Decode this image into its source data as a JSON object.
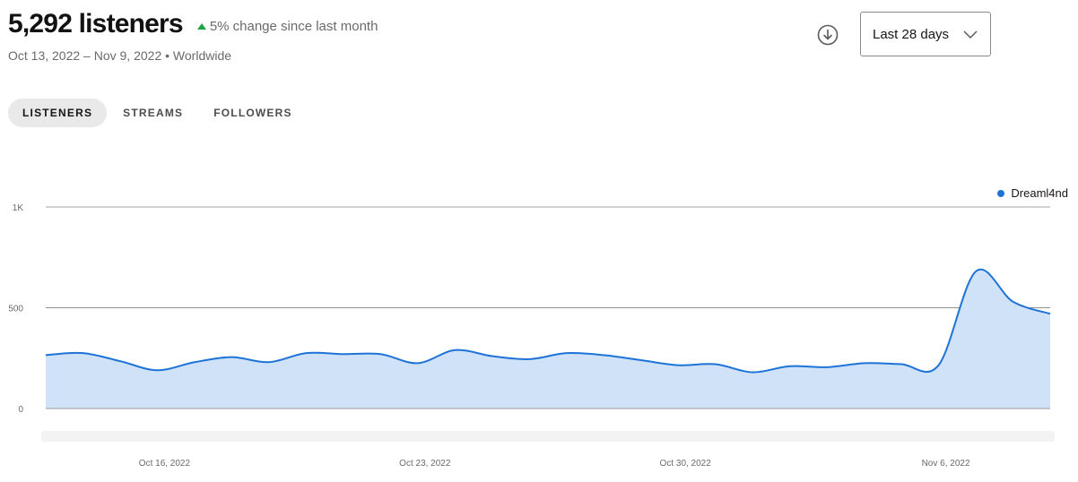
{
  "header": {
    "listener_count": "5,292 listeners",
    "change_text": "5% change since last month",
    "date_range": "Oct 13, 2022 – Nov 9, 2022",
    "region": "Worldwide",
    "separator": "•"
  },
  "controls": {
    "download_icon": "download-icon",
    "range_label": "Last 28 days"
  },
  "tabs": [
    {
      "label": "LISTENERS",
      "active": true
    },
    {
      "label": "STREAMS",
      "active": false
    },
    {
      "label": "FOLLOWERS",
      "active": false
    }
  ],
  "colors": {
    "accent": "#1e74d6",
    "fill": "#cfe2f8",
    "positive": "#1ea446"
  },
  "chart_data": {
    "type": "area",
    "legend": [
      "Dreaml4nd"
    ],
    "legend_position": "top-right",
    "grid": true,
    "x": [
      "2022-10-13",
      "2022-10-14",
      "2022-10-15",
      "2022-10-16",
      "2022-10-17",
      "2022-10-18",
      "2022-10-19",
      "2022-10-20",
      "2022-10-21",
      "2022-10-22",
      "2022-10-23",
      "2022-10-24",
      "2022-10-25",
      "2022-10-26",
      "2022-10-27",
      "2022-10-28",
      "2022-10-29",
      "2022-10-30",
      "2022-10-31",
      "2022-11-01",
      "2022-11-02",
      "2022-11-03",
      "2022-11-04",
      "2022-11-05",
      "2022-11-06",
      "2022-11-07",
      "2022-11-08",
      "2022-11-09"
    ],
    "xtick_labels": [
      "Oct 16, 2022",
      "Oct 23, 2022",
      "Oct 30, 2022",
      "Nov 6, 2022"
    ],
    "xtick_dates": [
      "2022-10-16",
      "2022-10-23",
      "2022-10-30",
      "2022-11-06"
    ],
    "ytick_labels": [
      "0",
      "500",
      "1K"
    ],
    "ytick_values": [
      0,
      500,
      1000
    ],
    "ylim": [
      0,
      1000
    ],
    "series": [
      {
        "name": "Dreaml4nd",
        "values": [
          265,
          275,
          235,
          190,
          230,
          255,
          230,
          275,
          270,
          270,
          225,
          290,
          260,
          245,
          275,
          265,
          240,
          215,
          220,
          180,
          210,
          205,
          225,
          220,
          215,
          680,
          530,
          470
        ]
      }
    ]
  }
}
